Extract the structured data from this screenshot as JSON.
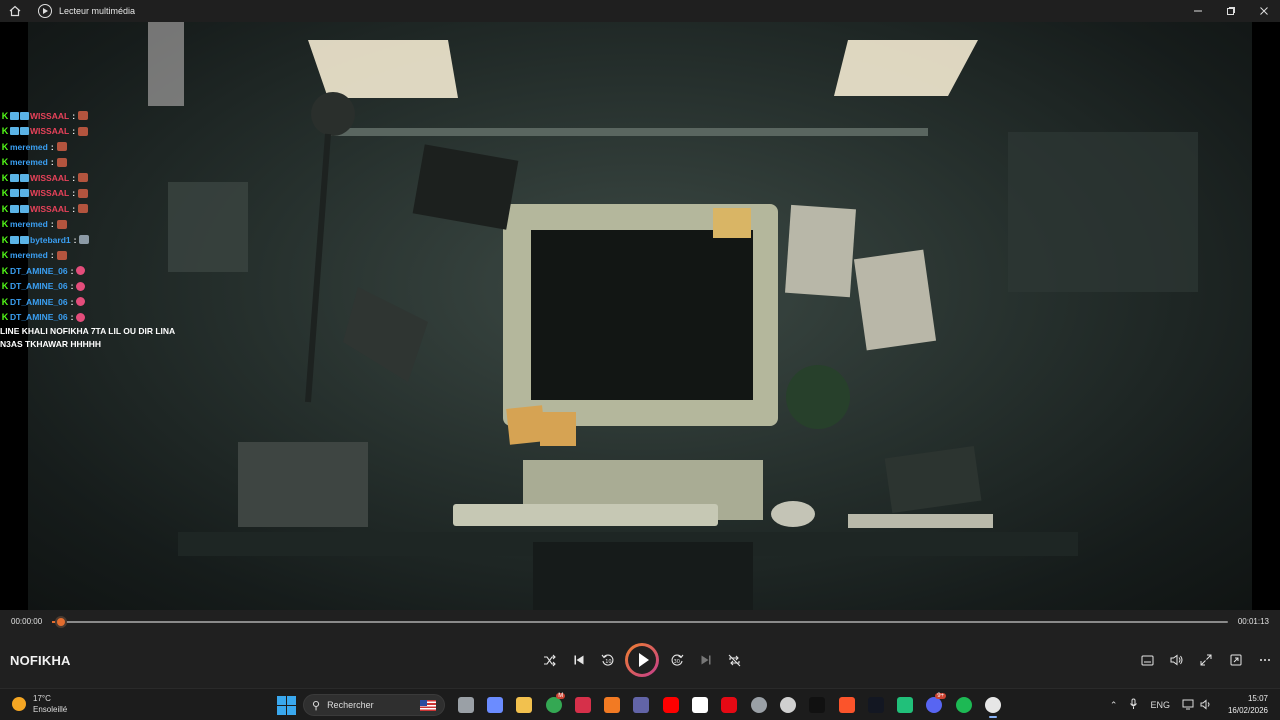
{
  "window": {
    "title": "Lecteur multimédia",
    "controls": [
      "minimize-icon",
      "restore-icon",
      "close-icon"
    ]
  },
  "chat": {
    "messages": [
      {
        "user": "WISSAAL",
        "color": "#e8425a",
        "badges": 2,
        "emote": "brick"
      },
      {
        "user": "WISSAAL",
        "color": "#e8425a",
        "badges": 2,
        "emote": "brick"
      },
      {
        "user": "meremed",
        "color": "#3a9ff2",
        "badges": 0,
        "emote": "brick"
      },
      {
        "user": "meremed",
        "color": "#3a9ff2",
        "badges": 0,
        "emote": "brick"
      },
      {
        "user": "WISSAAL",
        "color": "#e8425a",
        "badges": 2,
        "emote": "brick"
      },
      {
        "user": "WISSAAL",
        "color": "#e8425a",
        "badges": 2,
        "emote": "brick"
      },
      {
        "user": "WISSAAL",
        "color": "#e8425a",
        "badges": 2,
        "emote": "brick"
      },
      {
        "user": "meremed",
        "color": "#3a9ff2",
        "badges": 0,
        "emote": "brick"
      },
      {
        "user": "bytebard1",
        "color": "#3a9ff2",
        "badges": 2,
        "emote": "grey"
      },
      {
        "user": "meremed",
        "color": "#3a9ff2",
        "badges": 0,
        "emote": "brick"
      },
      {
        "user": "DT_AMINE_06",
        "color": "#3a9ff2",
        "badges": 0,
        "emote": "fire"
      },
      {
        "user": "DT_AMINE_06",
        "color": "#3a9ff2",
        "badges": 0,
        "emote": "fire"
      },
      {
        "user": "DT_AMINE_06",
        "color": "#3a9ff2",
        "badges": 0,
        "emote": "fire"
      },
      {
        "user": "DT_AMINE_06",
        "color": "#3a9ff2",
        "badges": 0,
        "emote": "fire"
      }
    ],
    "text_line_1": "LINE KHALI NOFIKHA 7TA LIL OU DIR LINA",
    "text_line_2": "N3AS TKHAWAR HHHHH"
  },
  "player": {
    "time_current": "00:00:00",
    "time_total": "00:01:13",
    "progress": 0.008,
    "media_title": "NOFIKHA",
    "accent": "#e36d2f"
  },
  "taskbar": {
    "weather_temp": "17°C",
    "weather_desc": "Ensoleillé",
    "search_placeholder": "Rechercher",
    "language": "ENG",
    "time": "15:07",
    "date": "16/02/2026",
    "apps": [
      {
        "name": "task-view-icon",
        "color": "#9aa0a6"
      },
      {
        "name": "copilot-icon",
        "color": "#6b8cff"
      },
      {
        "name": "file-explorer-icon",
        "color": "#f2c14e"
      },
      {
        "name": "chrome-icon",
        "color": "#34a853",
        "badge": "M"
      },
      {
        "name": "affinity-icon",
        "color": "#d6304a"
      },
      {
        "name": "brave-icon",
        "color": "#f27a23"
      },
      {
        "name": "teams-icon",
        "color": "#6264a7"
      },
      {
        "name": "youtube-icon",
        "color": "#ff0000"
      },
      {
        "name": "fn-app-icon",
        "color": "#ffffff"
      },
      {
        "name": "netflix-icon",
        "color": "#e50914"
      },
      {
        "name": "hummingbird-icon",
        "color": "#9aa0a6"
      },
      {
        "name": "chatgpt-icon",
        "color": "#d0d0d0"
      },
      {
        "name": "xm-icon",
        "color": "#111111"
      },
      {
        "name": "brave-browser-icon",
        "color": "#fb542b"
      },
      {
        "name": "tradingview-icon",
        "color": "#131722"
      },
      {
        "name": "tiktok-app-icon",
        "color": "#21c07a"
      },
      {
        "name": "discord-icon",
        "color": "#5865f2",
        "badge": "9+"
      },
      {
        "name": "spotify-icon",
        "color": "#1db954"
      },
      {
        "name": "media-player-icon",
        "color": "#e6e6e6"
      }
    ]
  }
}
